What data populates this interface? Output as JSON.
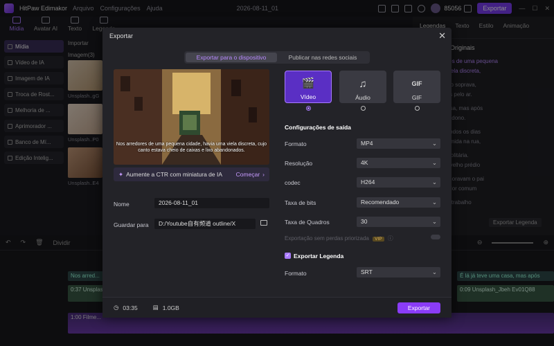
{
  "app": {
    "title": "HitPaw Edimakor",
    "menu": [
      "Arquivo",
      "Configurações",
      "Ajuda"
    ],
    "project": "2026-08-11_01",
    "credits": "85056",
    "export_label": "Exportar"
  },
  "toolbar": [
    {
      "label": "Mídia"
    },
    {
      "label": "Avatar AI"
    },
    {
      "label": "Texto"
    },
    {
      "label": "Legenda"
    }
  ],
  "sidebar": [
    "Mídia",
    "Vídeo de IA",
    "Imagem de IA",
    "Troca de Rost...",
    "Melhoria de ...",
    "Aprimorador ...",
    "Banco de Mí...",
    "Edição Intelig..."
  ],
  "media": {
    "import_label": "Importar",
    "group_label": "Imagem(3)",
    "captions": [
      "Unsplash..gG",
      "Unsplash..P0",
      "Unsplash..E4"
    ]
  },
  "rightpanel": {
    "tabs": [
      "Legendas",
      "Texto",
      "Estilo",
      "Animação"
    ],
    "heading": "Originais",
    "lines": [
      "Nos arredores de uma pequena",
      "havia uma viela discreta,",
      "frio do outono soprava,",
      "folhas caídas pelo ar.",
      "teve uma casa, mas após",
      "donado pelo dono.",
      "sobreviveu todos os dias",
      "restos de comida na rua,",
      "ara difícil e solitária.",
      "dali, em um velho prédio",
      "rtamentos, moravam o pai",
      "um trabalhador comum",
      "fábrica, com trabalho"
    ],
    "export_sub": "Exportar Legenda"
  },
  "timeline": {
    "split": "Dividir",
    "tracks": [
      "Nos arred...",
      "0:37 Unsplash",
      "1:00 Filme...",
      "É lá já teve uma casa, mas após",
      "0:09 Unsplash_Jbeh Ev01Q88"
    ]
  },
  "dialog": {
    "title": "Exportar",
    "tabs": [
      "Exportar para o dispositivo",
      "Publicar nas redes sociais"
    ],
    "caption": "Nos arredores de uma pequena cidade, havia uma viela discreta, cujo canto estava cheio de caixas e lixo abandonados.",
    "ctr_text": "Aumente a CTR com miniatura de IA",
    "ctr_action": "Começar",
    "name_label": "Nome",
    "name_value": "2026-08-11_01",
    "save_label": "Guardar para",
    "save_value": "D:/Youtube自有频道 outline/X",
    "formats": [
      {
        "label": "Vídeo",
        "icon": "video-icon"
      },
      {
        "label": "Áudio",
        "icon": "music-icon"
      },
      {
        "label": "GIF",
        "icon": "gif-icon"
      }
    ],
    "output_heading": "Configurações de saída",
    "settings": [
      {
        "label": "Formato",
        "value": "MP4"
      },
      {
        "label": "Resolução",
        "value": "4K"
      },
      {
        "label": "codec",
        "value": "H264"
      },
      {
        "label": "Taxa de bits",
        "value": "Recomendado"
      },
      {
        "label": "Taxa de Quadros",
        "value": "30"
      }
    ],
    "priority_label": "Exportação sem perdas priorizada",
    "vip": "VIP",
    "subtitle_heading": "Exportar Legenda",
    "subtitle_format_label": "Formato",
    "subtitle_format_value": "SRT",
    "duration": "03:35",
    "size": "1.0GB",
    "export_button": "Exportar"
  }
}
